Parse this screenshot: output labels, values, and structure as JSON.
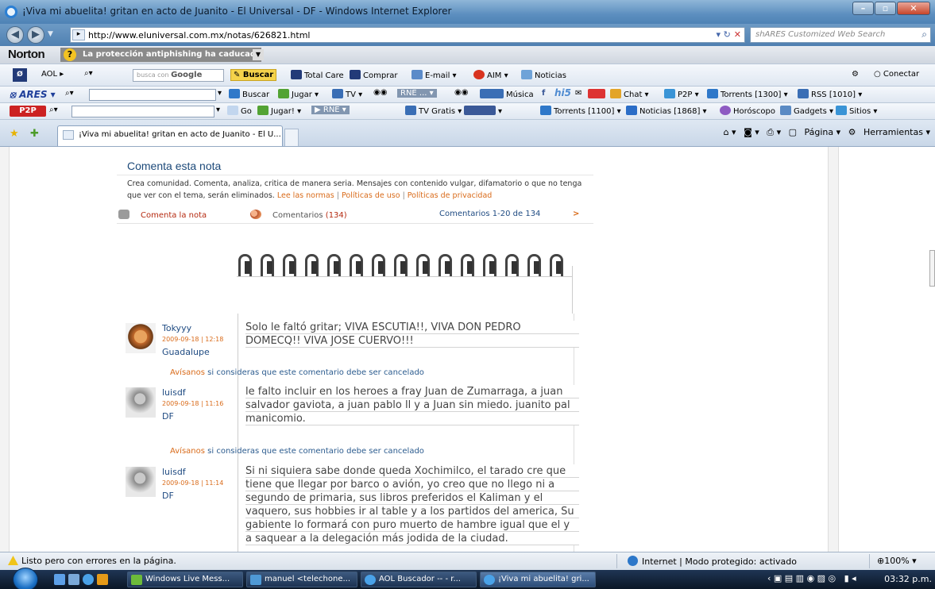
{
  "window": {
    "title": "¡Viva mi abuelita! gritan en acto de Juanito - El Universal - DF - Windows Internet Explorer"
  },
  "address_bar": {
    "url": "http://www.eluniversal.com.mx/notas/626821.html",
    "search_placeholder": "shARES Customized Web Search"
  },
  "norton": {
    "logo": "Norton",
    "warning": "La protección antiphishing ha caducado"
  },
  "aol_toolbar": {
    "brand": "AOL",
    "search_placeholder_prefix": "busca con",
    "search_placeholder_brand": "Google",
    "buscar": "Buscar",
    "total_care": "Total Care",
    "comprar": "Comprar",
    "email": "E-mail",
    "aim": "AIM",
    "noticias": "Noticias",
    "conectar": "Conectar"
  },
  "ares_toolbar": {
    "logo": "ARES",
    "buscar": "Buscar",
    "jugar": "Jugar",
    "tv": "TV",
    "rne": "RNE ...",
    "musica": "Música",
    "chat": "Chat",
    "p2p": "P2P",
    "torrents": "Torrents [1300]",
    "rss": "RSS [1010]"
  },
  "p2p_toolbar": {
    "logo": "P2P",
    "go": "Go",
    "jugar": "Jugar!",
    "rne": "RNE",
    "tv_gratis": "TV Gratis",
    "torrents": "Torrents [1100]",
    "noticias": "Noticias [1868]",
    "horoscopo": "Horóscopo",
    "gadgets": "Gadgets",
    "sitios": "Sitios"
  },
  "tab": {
    "label": "¡Viva mi abuelita! gritan en acto de Juanito - El U..."
  },
  "commandbar": {
    "pagina": "Página",
    "herramientas": "Herramientas"
  },
  "page": {
    "section_title": "Comenta esta nota",
    "description": "Crea comunidad. Comenta, analiza, critica de manera seria. Mensajes con contenido vulgar, difamatorio o que no tenga que ver con el tema, serán eliminados.",
    "link_normas": "Lee las normas",
    "link_uso": "Políticas de uso",
    "link_privacidad": "Políticas de privacidad",
    "comenta_label": "Comenta la nota",
    "comentarios_label": "Comentarios",
    "comentarios_count": "(134)",
    "range_label": "Comentarios 1-20 de 134",
    "next_arrow": ">",
    "report_link": "Avísanos",
    "report_rest": "si consideras que este comentario debe ser cancelado"
  },
  "comments": [
    {
      "user": "Tokyyy",
      "date": "2009-09-18 | 12:18",
      "location": "Guadalupe",
      "text": "Solo le faltó gritar; VIVA ESCUTIA!!, VIVA DON PEDRO DOMECQ!! VIVA JOSE CUERVO!!!"
    },
    {
      "user": "luisdf",
      "date": "2009-09-18 | 11:16",
      "location": "DF",
      "text": "le falto incluir en los heroes a fray Juan de Zumarraga, a juan salvador gaviota, a juan pablo ll y a Juan sin miedo. juanito pal manicomio."
    },
    {
      "user": "luisdf",
      "date": "2009-09-18 | 11:14",
      "location": "DF",
      "text": "Si ni siquiera sabe donde queda Xochimilco, el tarado cre que tiene que llegar por barco o avión, yo creo que no llego ni a segundo de primaria, sus libros preferidos el Kaliman y el vaquero, sus hobbies ir al table y a los partidos del america, Su gabiente lo formará con puro muerto de hambre igual que el y a saquear a la delegación más jodida de la ciudad."
    }
  ],
  "status": {
    "left": "Listo pero con errores en la página.",
    "zone": "Internet | Modo protegido: activado",
    "zoom": "100%"
  },
  "taskbar": {
    "tasks": [
      "Windows Live Mess...",
      "manuel <telechone...",
      "AOL Buscador -- - r...",
      "¡Viva mi abuelita! gri..."
    ],
    "clock": "03:32 p.m."
  }
}
